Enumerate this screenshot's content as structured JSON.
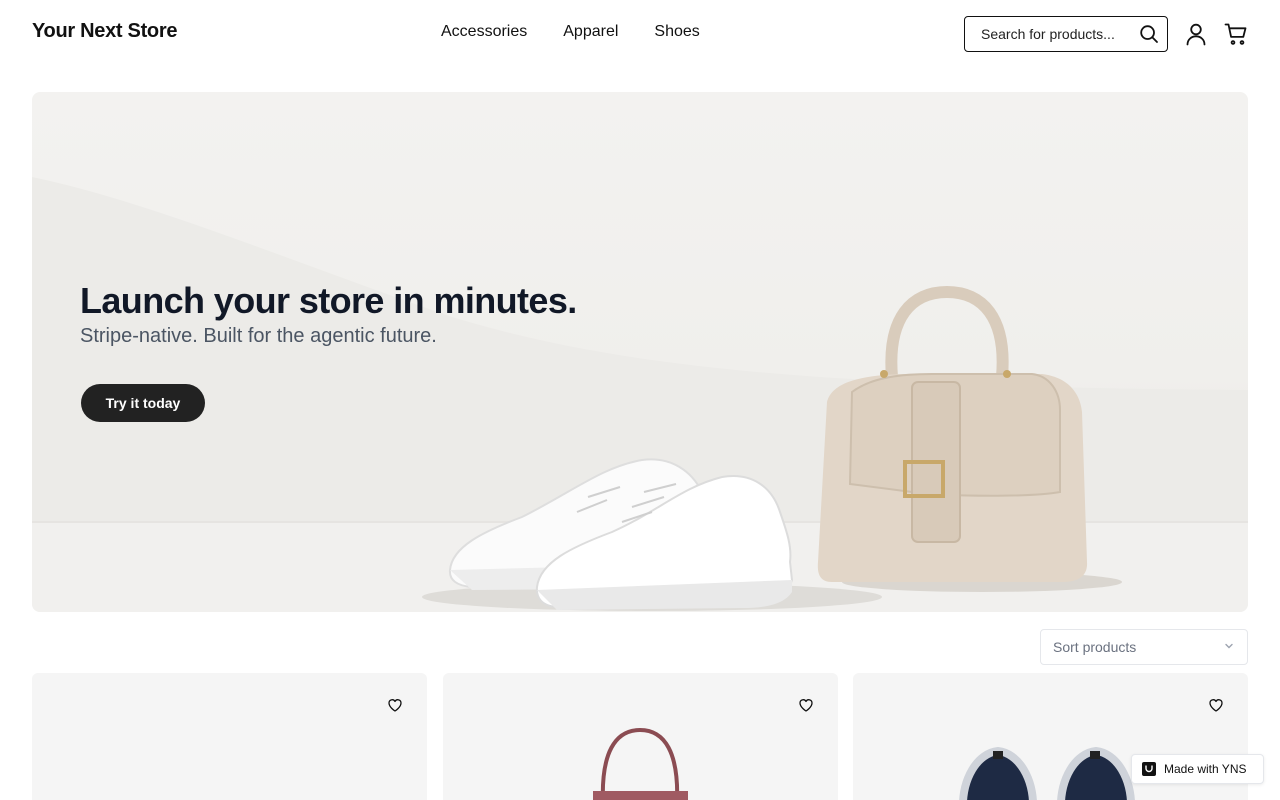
{
  "header": {
    "logo": "Your Next Store",
    "nav": [
      "Accessories",
      "Apparel",
      "Shoes"
    ],
    "search_placeholder": "Search for products...",
    "icons": {
      "search": "search-icon",
      "account": "user-icon",
      "cart": "cart-icon"
    }
  },
  "hero": {
    "title": "Launch your store in minutes.",
    "subtitle": "Stripe-native. Built for the agentic future.",
    "cta": "Try it today"
  },
  "sort": {
    "label": "Sort products"
  },
  "products": [
    {
      "image": "product-image-blank",
      "favorite_icon": "heart-icon"
    },
    {
      "image": "tote-bag-image",
      "favorite_icon": "heart-icon"
    },
    {
      "image": "sneakers-image",
      "favorite_icon": "heart-icon"
    }
  ],
  "badge": {
    "label": "Made with YNS"
  },
  "colors": {
    "cta_bg": "#222222",
    "hero_title": "#111827",
    "hero_sub": "#4b5563"
  }
}
